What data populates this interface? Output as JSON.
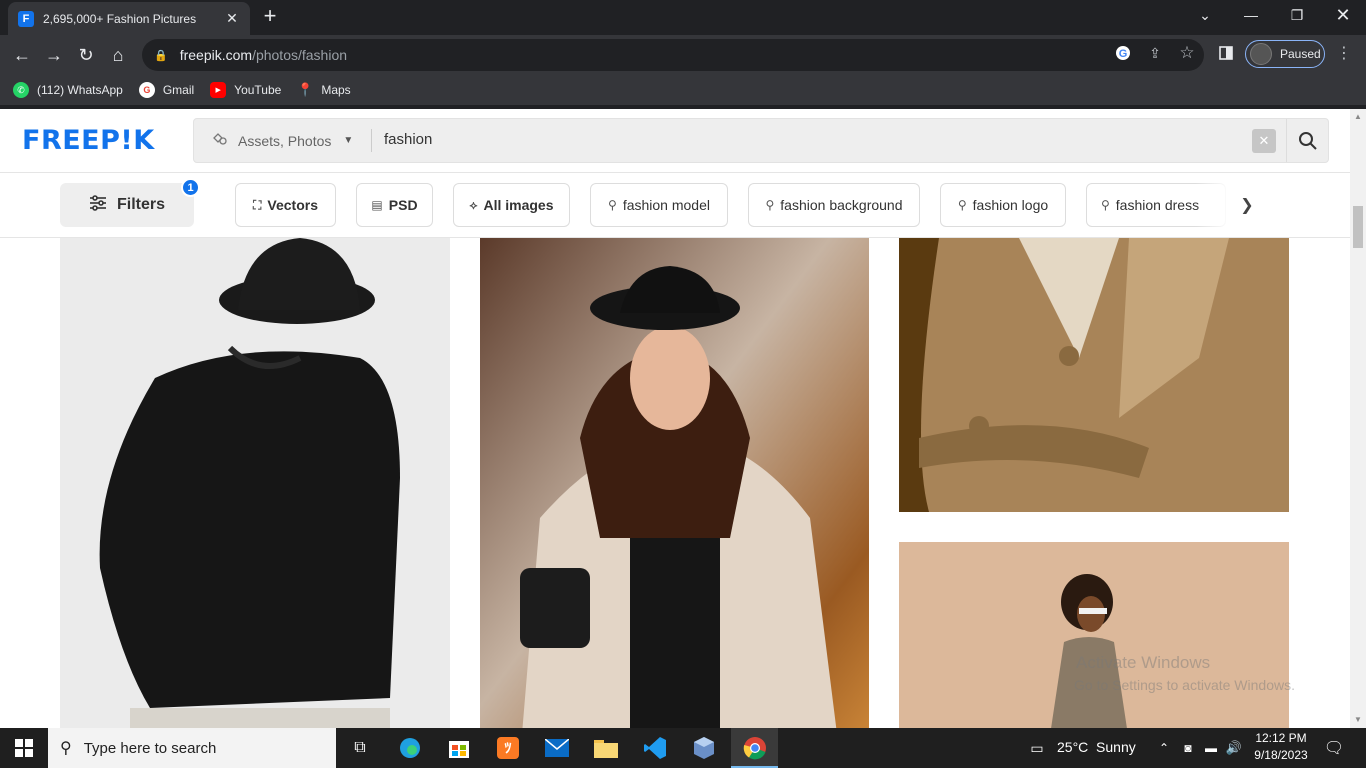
{
  "browser": {
    "tab_title": "2,695,000+ Fashion Pictures",
    "tab_favicon": "F",
    "url_host": "freepik.com",
    "url_path": "/photos/fashion",
    "profile_status": "Paused"
  },
  "bookmarks": [
    {
      "label": "(112) WhatsApp",
      "icon": "whatsapp-icon",
      "color": "#25d366"
    },
    {
      "label": "Gmail",
      "icon": "google-icon",
      "color": "#ffffff"
    },
    {
      "label": "YouTube",
      "icon": "youtube-icon",
      "color": "#ff0000"
    },
    {
      "label": "Maps",
      "icon": "maps-icon",
      "color": "#34a853"
    }
  ],
  "site": {
    "logo": "FREEP!K",
    "brand_color": "#1273eb",
    "search": {
      "asset_type": "Assets, Photos",
      "query": "fashion"
    },
    "filters": {
      "label": "Filters",
      "badge": "1"
    },
    "chips": [
      {
        "label": "Vectors",
        "icon": "vector-icon",
        "bold": true
      },
      {
        "label": "PSD",
        "icon": "psd-icon",
        "bold": true
      },
      {
        "label": "All images",
        "icon": "images-icon",
        "bold": true
      },
      {
        "label": "fashion model",
        "icon": "search-icon",
        "bold": false
      },
      {
        "label": "fashion background",
        "icon": "search-icon",
        "bold": false
      },
      {
        "label": "fashion logo",
        "icon": "search-icon",
        "bold": false
      },
      {
        "label": "fashion dress",
        "icon": "search-icon",
        "bold": false
      }
    ]
  },
  "watermark": {
    "line1": "Activate Windows",
    "line2": "Go to Settings to activate Windows."
  },
  "taskbar": {
    "search_placeholder": "Type here to search",
    "weather": "25°C  Sunny",
    "time": "12:12 PM",
    "date": "9/18/2023"
  }
}
